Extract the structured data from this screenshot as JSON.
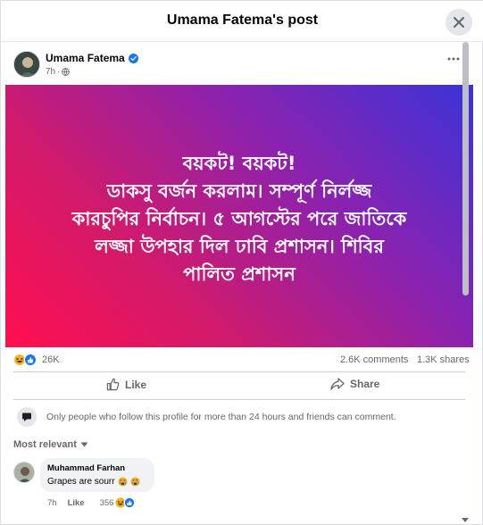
{
  "modal": {
    "title": "Umama Fatema's post"
  },
  "post": {
    "author": "Umama Fatema",
    "verified": true,
    "time": "7h",
    "audience_icon": "globe-icon",
    "image_text_lines": [
      "বয়কট! বয়কট!",
      "ডাকসু বর্জন করলাম। সম্পূর্ণ নির্লজ্জ",
      "কারচুপির নির্বাচন। ৫ আগস্টের পরে জাতিকে",
      "লজ্জা উপহার দিল ঢাবি প্রশাসন। শিবির",
      "পালিত প্রশাসন"
    ],
    "gradient_colors": [
      "#ff0f4f",
      "#d31a6a",
      "#8a22b0",
      "#3b33d8"
    ]
  },
  "stats": {
    "reactions_count": "26K",
    "reaction_icons": [
      "haha-icon",
      "like-icon"
    ],
    "comments": "2.6K comments",
    "shares": "1.3K shares"
  },
  "actions": {
    "like_label": "Like",
    "share_label": "Share"
  },
  "notice": {
    "text": "Only people who follow this profile for more than 24 hours and friends can comment."
  },
  "sort": {
    "label": "Most relevant"
  },
  "comments": [
    {
      "author": "Muhammad Farhan",
      "text": "Grapes are sourr",
      "emojis": [
        "crying-icon",
        "crying-icon"
      ],
      "time": "7h",
      "like_label": "Like",
      "reaction_count": "356"
    }
  ],
  "colors": {
    "accent": "#1877f2",
    "secondary_text": "#65676b",
    "bubble": "#f0f2f5"
  }
}
